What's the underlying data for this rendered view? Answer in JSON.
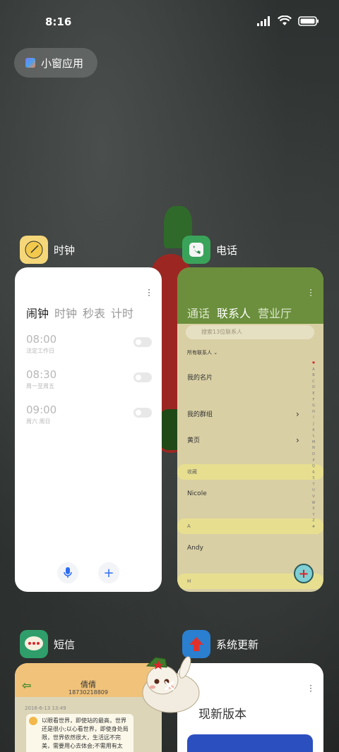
{
  "status_bar": {
    "time": "8:16"
  },
  "small_window": {
    "label": "小窗应用"
  },
  "colors": {
    "phone_head": "#6b8f3c",
    "phone_bg": "#d9cfa4",
    "sms_head": "#f0c27a",
    "update_banner": "#2c4fbf",
    "accent_blue": "#2d6df6"
  },
  "apps": {
    "clock": {
      "name": "时钟",
      "tabs": [
        "闹钟",
        "时钟",
        "秒表",
        "计时"
      ],
      "alarms": [
        {
          "time": "08:00",
          "repeat": "法定工作日",
          "enabled": false
        },
        {
          "time": "08:30",
          "repeat": "周一至周五",
          "enabled": false
        },
        {
          "time": "09:00",
          "repeat": "周六 周日",
          "enabled": false
        }
      ],
      "buttons": {
        "voice_icon": "mic-icon",
        "add_icon": "plus-icon",
        "add_glyph": "+"
      }
    },
    "phone": {
      "name": "电话",
      "tabs": [
        "通话",
        "联系人",
        "营业厅"
      ],
      "search_placeholder": "搜索13位联系人",
      "filter": "所有联系人",
      "rows": {
        "my_card": "我的名片",
        "my_groups": "我的群组",
        "yellow_pages": "黄页",
        "favorites_header": "收藏",
        "contact_1": "Nicole",
        "section_a": "A",
        "contact_2": "Andy",
        "section_h": "H"
      },
      "index": [
        "♥",
        "A",
        "B",
        "C",
        "D",
        "E",
        "F",
        "G",
        "H",
        "I",
        "J",
        "K",
        "L",
        "M",
        "N",
        "O",
        "P",
        "Q",
        "R",
        "S",
        "T",
        "U",
        "V",
        "W",
        "X",
        "Y",
        "Z",
        "#"
      ],
      "fab_glyph": "+"
    },
    "sms": {
      "name": "短信",
      "contact_name": "倩倩",
      "contact_number": "18730218809",
      "date": "2016-6-13 13:49",
      "message": "以眼看世界，即使站的最高，世界还是很小;以心看世界，即使身处局限，世界依然很大，生活远不完美，需要用心去体会;不需用有太"
    },
    "update": {
      "name": "系统更新",
      "headline": "现新版本"
    }
  }
}
